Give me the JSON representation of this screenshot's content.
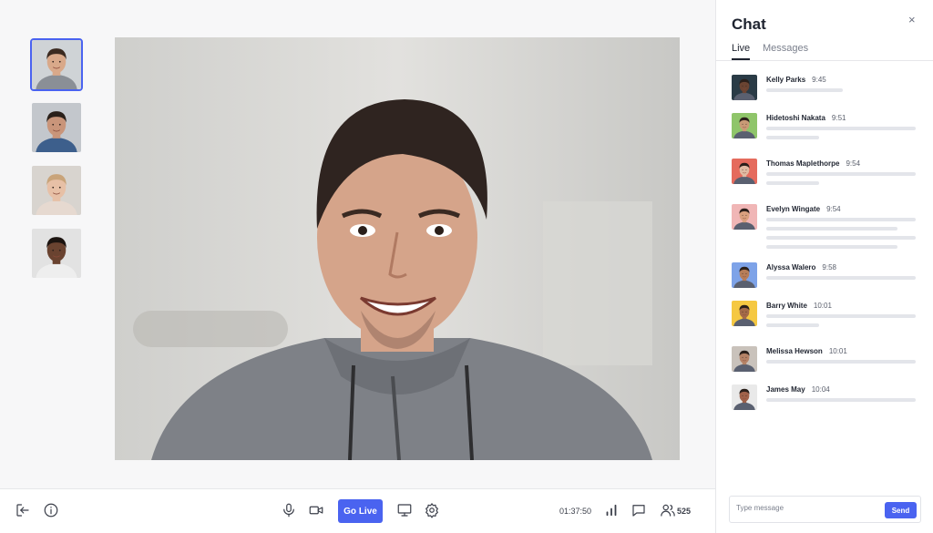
{
  "participants": [
    {
      "name": "thumb-participant-1",
      "skin": "#d9a98a",
      "hair": "#3b2a20",
      "bg": "#cfd3d6",
      "shirt": "#8a8f96",
      "active": true
    },
    {
      "name": "thumb-participant-2",
      "skin": "#c9957a",
      "hair": "#2a201a",
      "bg": "#c3c7cc",
      "shirt": "#3d5f8c",
      "active": false
    },
    {
      "name": "thumb-participant-3",
      "skin": "#e7c0a6",
      "hair": "#c9a47a",
      "bg": "#d8d4cf",
      "shirt": "#e6d9d0",
      "active": false
    },
    {
      "name": "thumb-participant-4",
      "skin": "#6a4330",
      "hair": "#1c1410",
      "bg": "#e2e2e2",
      "shirt": "#eeeeee",
      "active": false
    }
  ],
  "main_video": {
    "skin": "#d5a48a",
    "hair": "#2f2420",
    "bg": "#d8d8d4",
    "shirt": "#7e8187"
  },
  "toolbar": {
    "go_live_label": "Go Live",
    "timer": "01:37:50",
    "participant_count": "525"
  },
  "chat": {
    "title": "Chat",
    "close": "×",
    "tabs": [
      {
        "label": "Live",
        "active": true
      },
      {
        "label": "Messages",
        "active": false
      }
    ],
    "messages": [
      {
        "author": "Kelly Parks",
        "time": "9:45",
        "color": "#2a3b46",
        "skin": "#6b4432",
        "lines": [
          84
        ]
      },
      {
        "author": "Hidetoshi Nakata",
        "time": "9:51",
        "color": "#8fc56a",
        "skin": "#c99a76",
        "lines": [
          164,
          58
        ]
      },
      {
        "author": "Thomas Maplethorpe",
        "time": "9:54",
        "color": "#e56b5d",
        "skin": "#e0bba3",
        "lines": [
          164,
          58
        ]
      },
      {
        "author": "Evelyn Wingate",
        "time": "9:54",
        "color": "#f0b6b6",
        "skin": "#d9a07e",
        "lines": [
          164,
          144,
          164,
          144
        ]
      },
      {
        "author": "Alyssa Walero",
        "time": "9:58",
        "color": "#7ea3e8",
        "skin": "#b77d58",
        "lines": [
          164
        ]
      },
      {
        "author": "Barry White",
        "time": "10:01",
        "color": "#f5c842",
        "skin": "#a46a48",
        "lines": [
          164,
          58
        ]
      },
      {
        "author": "Melissa Hewson",
        "time": "10:01",
        "color": "#c9c2bb",
        "skin": "#b58266",
        "lines": [
          164
        ]
      },
      {
        "author": "James May",
        "time": "10:04",
        "color": "#e9e9e9",
        "skin": "#a0624a",
        "lines": [
          164
        ]
      }
    ],
    "input_placeholder": "Type message",
    "send_label": "Send"
  }
}
